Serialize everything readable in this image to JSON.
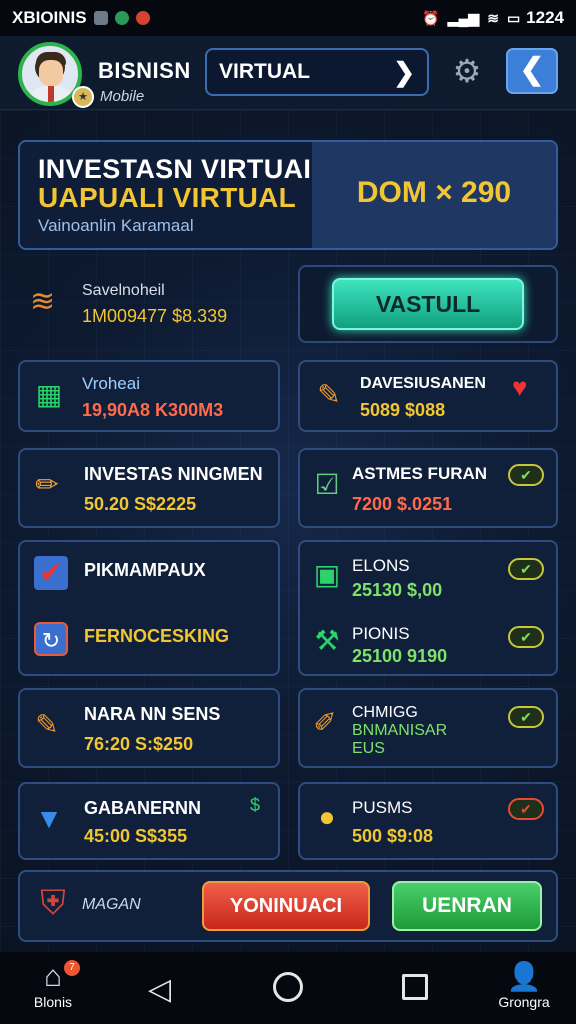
{
  "status_bar": {
    "left_text": "XBIOINIS",
    "time": "1224"
  },
  "header": {
    "user_name": "BISNISN",
    "user_subtitle": "Mobile",
    "search_value": "VIRTUAL"
  },
  "hero": {
    "title_line1": "INVESTASN VIRTUAI",
    "title_line2": "UAPUALI VIRTUAL",
    "subtitle": "Vainoanlin Karamaal",
    "amount": "DOM × 290"
  },
  "savings": {
    "label": "Savelnoheil",
    "value": "1M009477 $8.339"
  },
  "primary_button": {
    "label": "VASTULL"
  },
  "cards": [
    {
      "title": "Vroheai",
      "value": "19,90A8 K300M3"
    },
    {
      "title": "DAVESIUSANEN",
      "value": "5089 $088"
    },
    {
      "title": "INVESTAS NINGMEN",
      "value": "50.20 S$2225"
    },
    {
      "title": "ASTMES FURAN",
      "value": "7200 $.0251"
    },
    {
      "title": "PIKMAMPAUX",
      "title2": "FERNOCESKING"
    },
    {
      "title": "ELONS",
      "value": "25130 $,00",
      "title2": "PIONIS",
      "value2": "25100 9190"
    },
    {
      "title": "NARA NN SENS",
      "value": "76:20 S:$250"
    },
    {
      "title": "CHMIGG",
      "value": "BNMANISAR",
      "value_b": "EUS"
    },
    {
      "title": "GABANERNN",
      "value": "45:00 S$355"
    },
    {
      "title": "PUSMS",
      "value": "500 $9:08"
    }
  ],
  "bottom_panel": {
    "label": "MAGAN",
    "red_button": "YONINUACI",
    "green_button": "UENRAN"
  },
  "nav": {
    "home_label": "Blonis",
    "home_badge": "7",
    "profile_label": "Grongra"
  },
  "colors": {
    "accent_gold": "#f2c632",
    "accent_teal": "#2ee1b8",
    "panel_border": "#2d4c80",
    "button_red": "#d8331f",
    "button_green": "#2bb24c"
  }
}
